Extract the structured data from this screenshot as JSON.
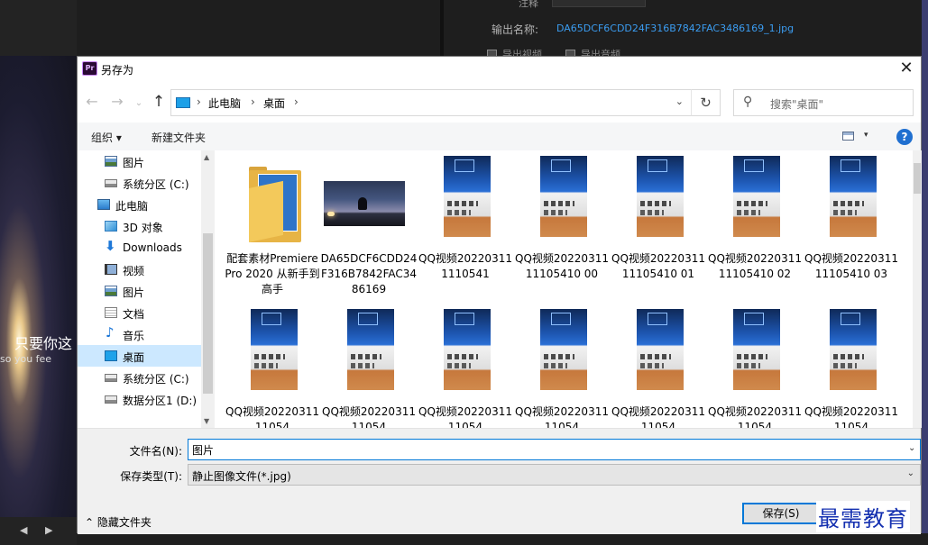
{
  "background": {
    "subtitle_zh": "只要你这",
    "subtitle_en": "so you fee",
    "controls": "◀ ▶",
    "note_label": "注释",
    "output_name_label": "输出名称:",
    "output_name_value": "DA65DCF6CDD24F316B7842FAC3486169_1.jpg",
    "export_video_label": "导出视频",
    "export_audio_label": "导出音频"
  },
  "dialog": {
    "title": "另存为",
    "app_icon_text": "Pr",
    "close_glyph": "✕",
    "nav": {
      "back": "←",
      "forward": "→",
      "recent": "⌄",
      "up": "↑",
      "address_segments": [
        "此电脑",
        "桌面"
      ],
      "separator": "›",
      "address_dropdown": "⌄",
      "refresh": "↻",
      "search_placeholder": "搜索\"桌面\""
    },
    "toolbar": {
      "organize": "组织 ▾",
      "new_folder": "新建文件夹",
      "view_arrow": "▾",
      "help": "?"
    },
    "nav_pane": [
      {
        "label": "图片",
        "icon": "pictures-icon",
        "indent": 1
      },
      {
        "label": "系统分区 (C:)",
        "icon": "drive-icon",
        "indent": 1
      },
      {
        "label": "此电脑",
        "icon": "computer-icon",
        "indent": 0
      },
      {
        "label": "3D 对象",
        "icon": "3d-objects-icon",
        "indent": 1
      },
      {
        "label": "Downloads",
        "icon": "downloads-icon",
        "indent": 1
      },
      {
        "label": "视频",
        "icon": "videos-icon",
        "indent": 1
      },
      {
        "label": "图片",
        "icon": "pictures-icon",
        "indent": 1
      },
      {
        "label": "文档",
        "icon": "documents-icon",
        "indent": 1
      },
      {
        "label": "音乐",
        "icon": "music-icon",
        "indent": 1
      },
      {
        "label": "桌面",
        "icon": "desktop-icon",
        "indent": 1,
        "selected": true
      },
      {
        "label": "系统分区 (C:)",
        "icon": "drive-icon",
        "indent": 1
      },
      {
        "label": "数据分区1 (D:)",
        "icon": "drive-icon",
        "indent": 1
      }
    ],
    "files": [
      {
        "name": "配套素材Premiere Pro 2020 从新手到高手",
        "type": "folder"
      },
      {
        "name": "DA65DCF6CDD24F316B7842FAC3486169",
        "type": "landscape"
      },
      {
        "name": "QQ视频202203111110541",
        "type": "phone"
      },
      {
        "name": "QQ视频2022031111105410 00",
        "type": "phone"
      },
      {
        "name": "QQ视频2022031111105410 01",
        "type": "phone"
      },
      {
        "name": "QQ视频2022031111105410 02",
        "type": "phone"
      },
      {
        "name": "QQ视频2022031111105410 03",
        "type": "phone"
      },
      {
        "name": "QQ视频2022031111054",
        "type": "phone"
      },
      {
        "name": "QQ视频2022031111054",
        "type": "phone"
      },
      {
        "name": "QQ视频2022031111054",
        "type": "phone"
      },
      {
        "name": "QQ视频2022031111054",
        "type": "phone"
      },
      {
        "name": "QQ视频2022031111054",
        "type": "phone"
      },
      {
        "name": "QQ视频2022031111054",
        "type": "phone"
      },
      {
        "name": "QQ视频2022031111054",
        "type": "phone"
      }
    ],
    "filename_label": "文件名(N):",
    "filename_value": "图片",
    "filetype_label": "保存类型(T):",
    "filetype_value": "静止图像文件(*.jpg)",
    "hide_folders": "隐藏文件夹",
    "hide_folders_arrow": "⌃",
    "save_label": "保存(S)",
    "watermark": "最需教育"
  }
}
